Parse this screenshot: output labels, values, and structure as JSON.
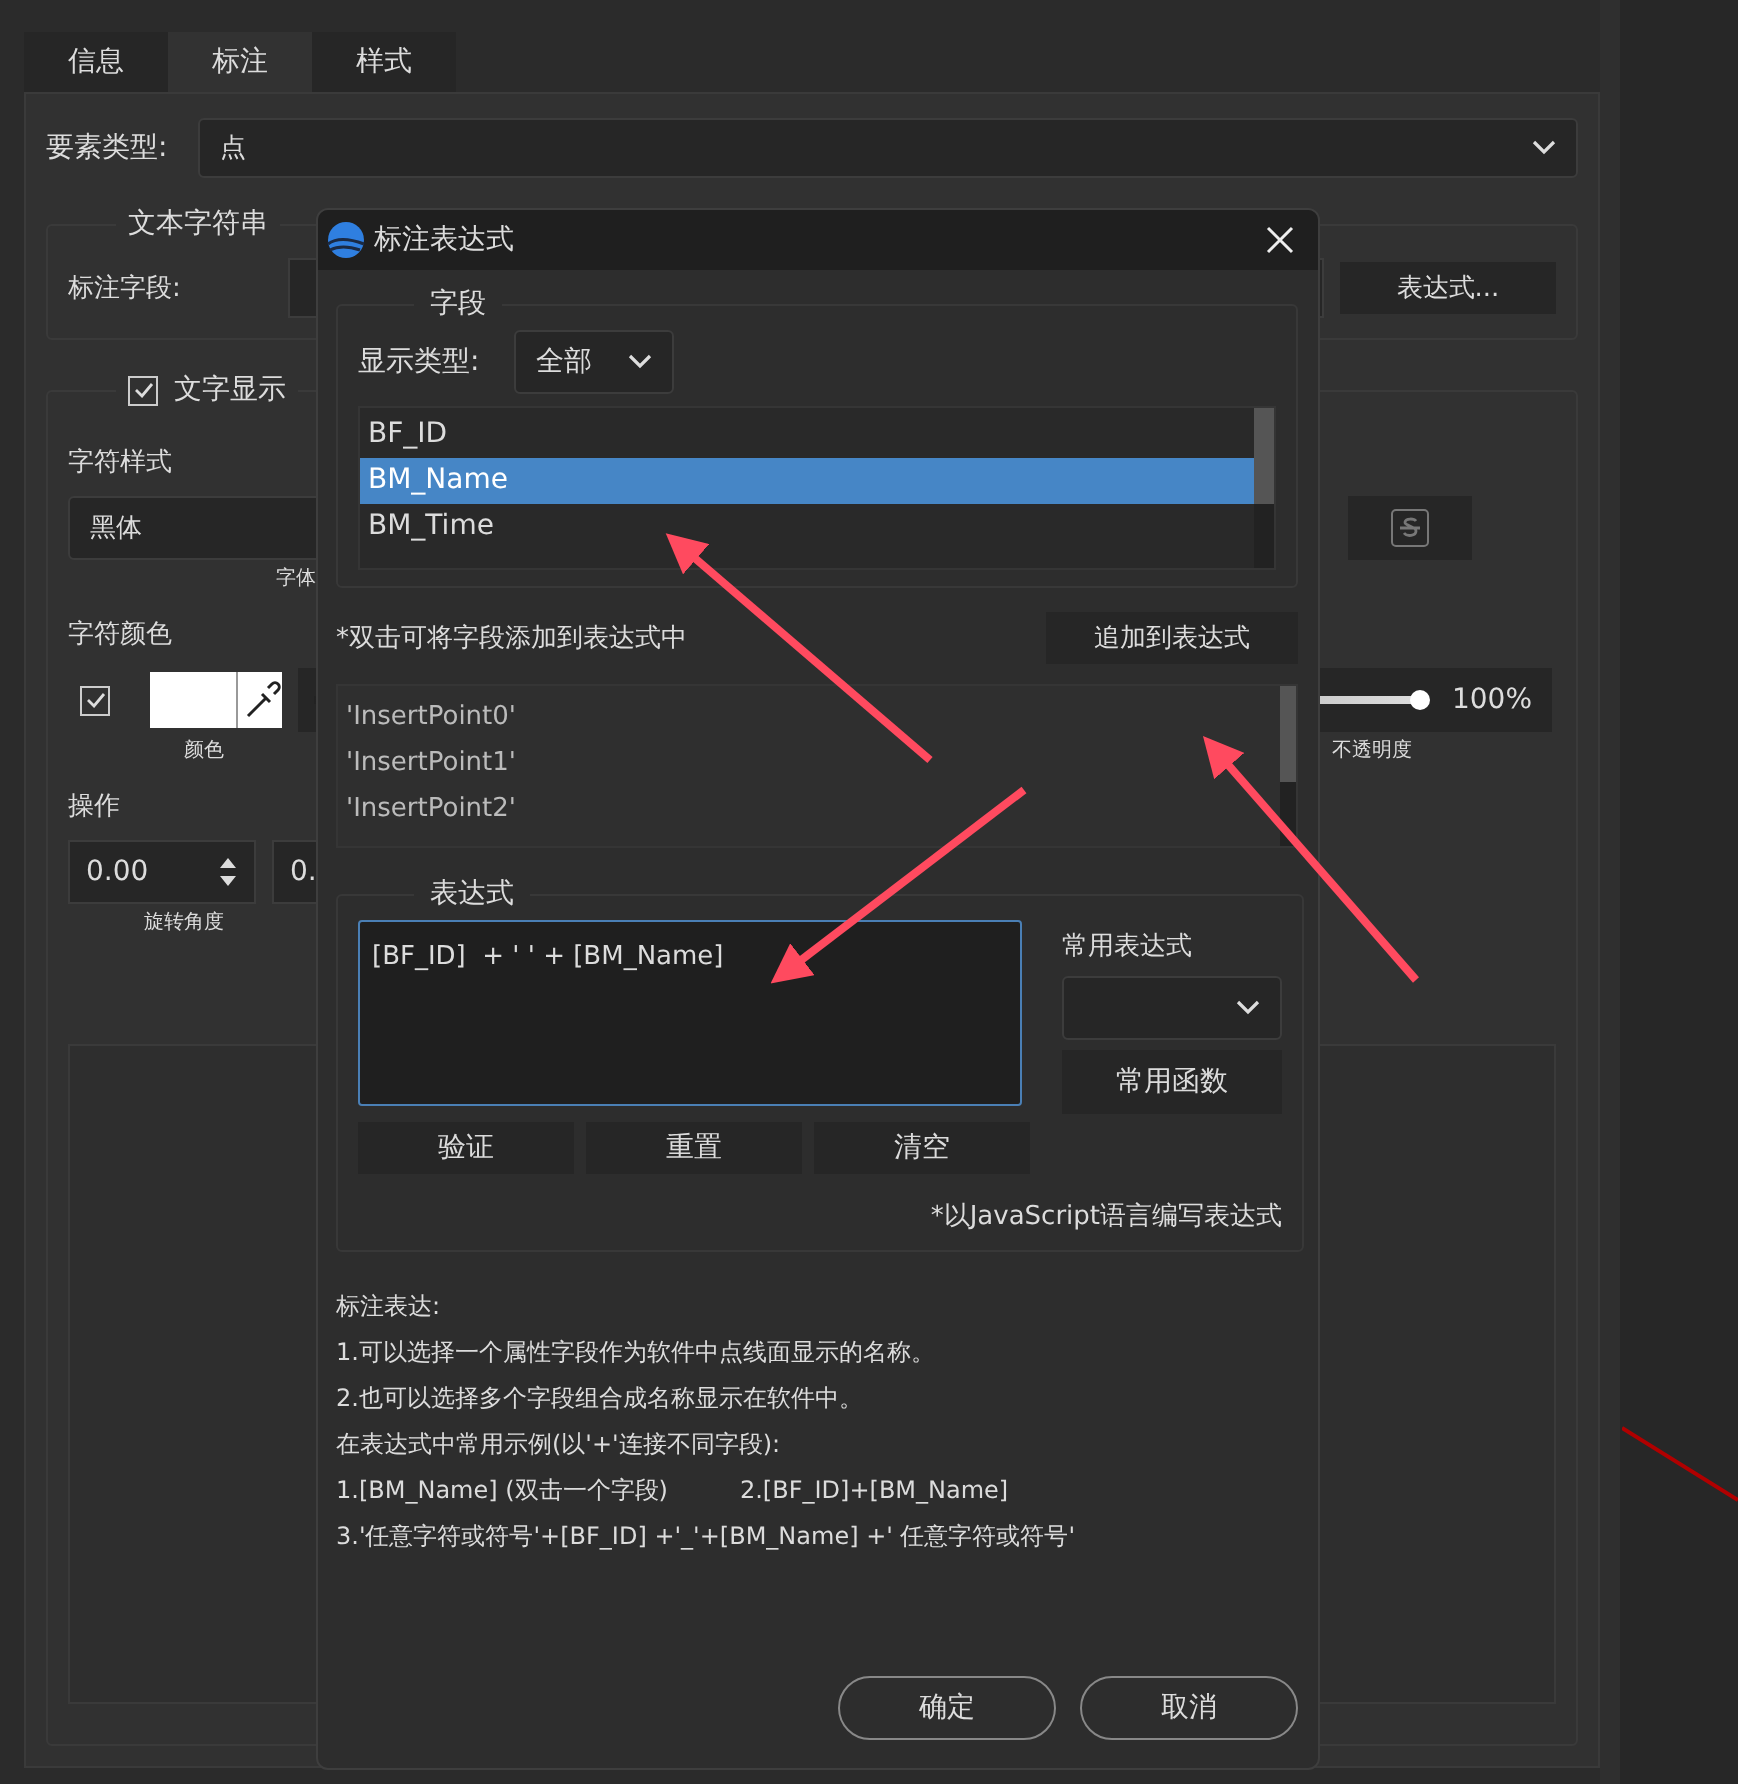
{
  "panel": {
    "tabs": [
      {
        "label": "信息",
        "selected": false
      },
      {
        "label": "标注",
        "selected": true
      },
      {
        "label": "样式",
        "selected": false
      }
    ],
    "element_type": {
      "label": "要素类型:",
      "value": "点"
    },
    "text_string_group": {
      "title": "文本字符串",
      "field_label": "标注字段:",
      "expression_button": "表达式..."
    },
    "text_display_group": {
      "title": "文字显示",
      "checked": true,
      "char_style_label": "字符样式",
      "font": "黑体",
      "font_caption": "字体",
      "char_color_label": "字符颜色",
      "color_checked": true,
      "color_caption": "颜色",
      "opacity": {
        "level": 1,
        "reading": "100%",
        "caption": "不透明度"
      },
      "operation_label": "操作",
      "rotation": "0.00",
      "spin_2": "0.",
      "rotation_caption": "旋转角度"
    }
  },
  "dialog": {
    "title": "标注表达式",
    "field_group": {
      "title": "字段",
      "type_label": "显示类型:",
      "type_value": "全部",
      "fields": [
        {
          "name": "BF_ID",
          "selected": false
        },
        {
          "name": "BM_Name",
          "selected": true
        },
        {
          "name": "BM_Time",
          "selected": false
        }
      ]
    },
    "hint": "*双击可将字段添加到表达式中",
    "append_button": "追加到表达式",
    "values": [
      "'InsertPoint0'",
      "'InsertPoint1'",
      "'InsertPoint2'"
    ],
    "expression_group": {
      "title": "表达式",
      "value": "[BF_ID]  + ' ' + [BM_Name]",
      "common_label": "常用表达式",
      "functions_button": "常用函数",
      "buttons": [
        "验证",
        "重置",
        "清空"
      ],
      "note": "*以JavaScript语言编写表达式"
    },
    "help": {
      "title": "标注表达:",
      "lines": [
        "1.可以选择一个属性字段作为软件中点线面显示的名称。",
        "2.也可以选择多个字段组合成名称显示在软件中。",
        "在表达式中常用示例(以'+'连接不同字段):"
      ],
      "example_1": "1.[BM_Name]  (双击一个字段)",
      "example_2": "2.[BF_ID]+[BM_Name]",
      "example_3": "3.'任意字符或符号'+[BF_ID] +'_'+[BM_Name] +' 任意字符或符号'"
    },
    "ok_button": "确定",
    "cancel_button": "取消"
  }
}
